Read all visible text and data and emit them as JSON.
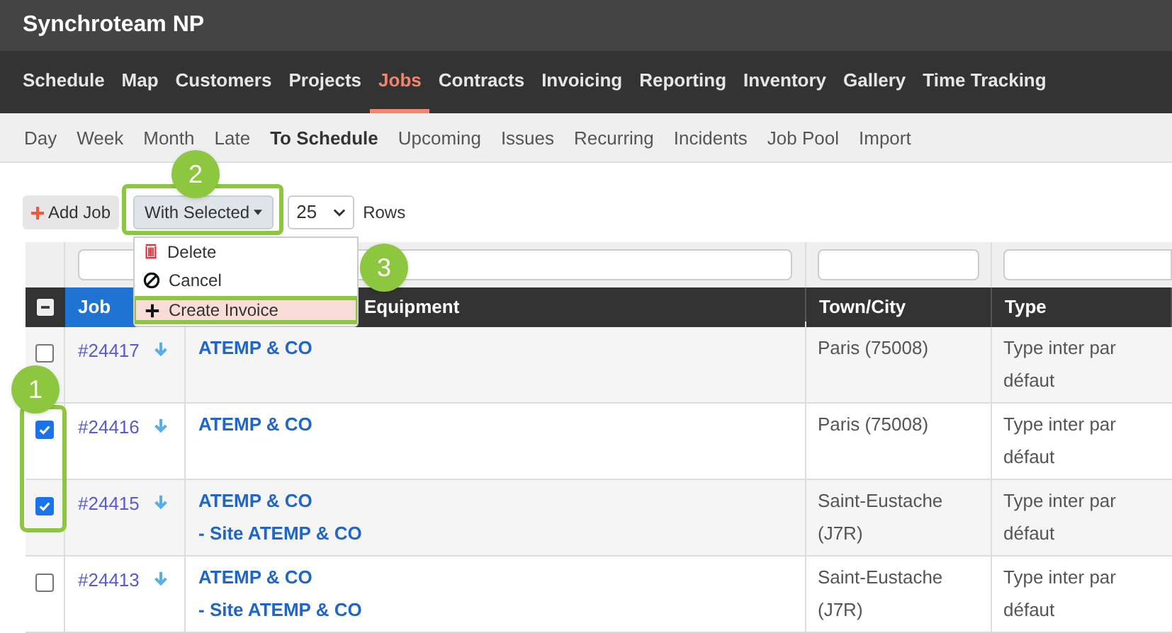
{
  "app": {
    "title": "Synchroteam NP"
  },
  "nav": [
    {
      "label": "Schedule",
      "selected": false
    },
    {
      "label": "Map",
      "selected": false
    },
    {
      "label": "Customers",
      "selected": false
    },
    {
      "label": "Projects",
      "selected": false
    },
    {
      "label": "Jobs",
      "selected": true
    },
    {
      "label": "Contracts",
      "selected": false
    },
    {
      "label": "Invoicing",
      "selected": false
    },
    {
      "label": "Reporting",
      "selected": false
    },
    {
      "label": "Inventory",
      "selected": false
    },
    {
      "label": "Gallery",
      "selected": false
    },
    {
      "label": "Time Tracking",
      "selected": false
    }
  ],
  "subnav": [
    {
      "label": "Day",
      "selected": false
    },
    {
      "label": "Week",
      "selected": false
    },
    {
      "label": "Month",
      "selected": false
    },
    {
      "label": "Late",
      "selected": false
    },
    {
      "label": "To Schedule",
      "selected": true
    },
    {
      "label": "Upcoming",
      "selected": false
    },
    {
      "label": "Issues",
      "selected": false
    },
    {
      "label": "Recurring",
      "selected": false
    },
    {
      "label": "Incidents",
      "selected": false
    },
    {
      "label": "Job Pool",
      "selected": false
    },
    {
      "label": "Import",
      "selected": false
    }
  ],
  "toolbar": {
    "add_button": "Add Job",
    "with_selected": "With Selected",
    "rows_value": "25",
    "rows_label": "Rows"
  },
  "menu": [
    {
      "kind": "delete",
      "label": "Delete",
      "selected": false
    },
    {
      "kind": "cancel",
      "label": "Cancel",
      "selected": false
    },
    {
      "kind": "add",
      "label": "Create Invoice",
      "selected": true
    }
  ],
  "table": {
    "columns": [
      {
        "label": "Job",
        "sorted": true
      },
      {
        "label": "Equipment",
        "sorted": false
      },
      {
        "label": "Town/City",
        "sorted": false
      },
      {
        "label": "Type",
        "sorted": false
      }
    ],
    "rows": [
      {
        "checked": false,
        "job": "#24417",
        "customer": "ATEMP & CO",
        "site": null,
        "town": "Paris (75008)",
        "type": "Type inter par défaut"
      },
      {
        "checked": true,
        "job": "#24416",
        "customer": "ATEMP & CO",
        "site": null,
        "town": "Paris (75008)",
        "type": "Type inter par défaut"
      },
      {
        "checked": true,
        "job": "#24415",
        "customer": "ATEMP & CO",
        "site": "- Site ATEMP & CO",
        "town": "Saint-Eustache (J7R)",
        "type": "Type inter par défaut"
      },
      {
        "checked": false,
        "job": "#24413",
        "customer": "ATEMP & CO",
        "site": "- Site ATEMP & CO",
        "town": "Saint-Eustache (J7R)",
        "type": "Type inter par défaut"
      }
    ]
  },
  "annotations": [
    {
      "label": "1"
    },
    {
      "label": "2"
    },
    {
      "label": "3"
    }
  ]
}
